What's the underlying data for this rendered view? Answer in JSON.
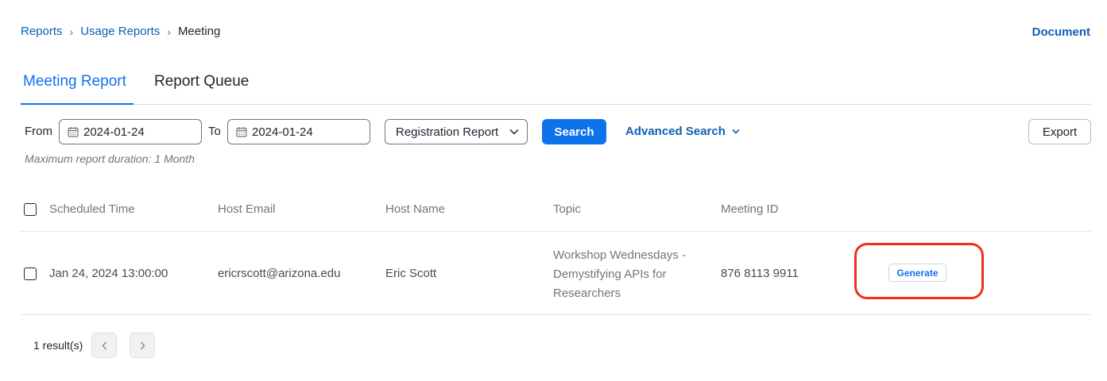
{
  "breadcrumb": {
    "items": [
      "Reports",
      "Usage Reports"
    ],
    "current": "Meeting",
    "separator": "›"
  },
  "header": {
    "doc_link": "Document"
  },
  "tabs": [
    {
      "label": "Meeting Report",
      "active": true
    },
    {
      "label": "Report Queue",
      "active": false
    }
  ],
  "filters": {
    "from_label": "From",
    "from_value": "2024-01-24",
    "to_label": "To",
    "to_value": "2024-01-24",
    "report_type": "Registration Report",
    "search_label": "Search",
    "advanced_search_label": "Advanced Search",
    "export_label": "Export",
    "hint": "Maximum report duration: 1 Month"
  },
  "table": {
    "columns": [
      "Scheduled Time",
      "Host Email",
      "Host Name",
      "Topic",
      "Meeting ID"
    ],
    "rows": [
      {
        "scheduled_time": "Jan 24, 2024 13:00:00",
        "host_email": "ericrscott@arizona.edu",
        "host_name": "Eric Scott",
        "topic_lines": [
          "Workshop Wednesdays -",
          "Demystifying APIs for",
          "Researchers"
        ],
        "meeting_id": "876 8113 9911",
        "action_label": "Generate"
      }
    ]
  },
  "pagination": {
    "result_text": "1 result(s)"
  },
  "colors": {
    "accent": "#0e72ed",
    "link": "#0e5fb5",
    "highlight": "#f0301a"
  },
  "icons": [
    "calendar-icon",
    "chevron-down-icon",
    "chevron-left-icon",
    "chevron-right-icon"
  ]
}
